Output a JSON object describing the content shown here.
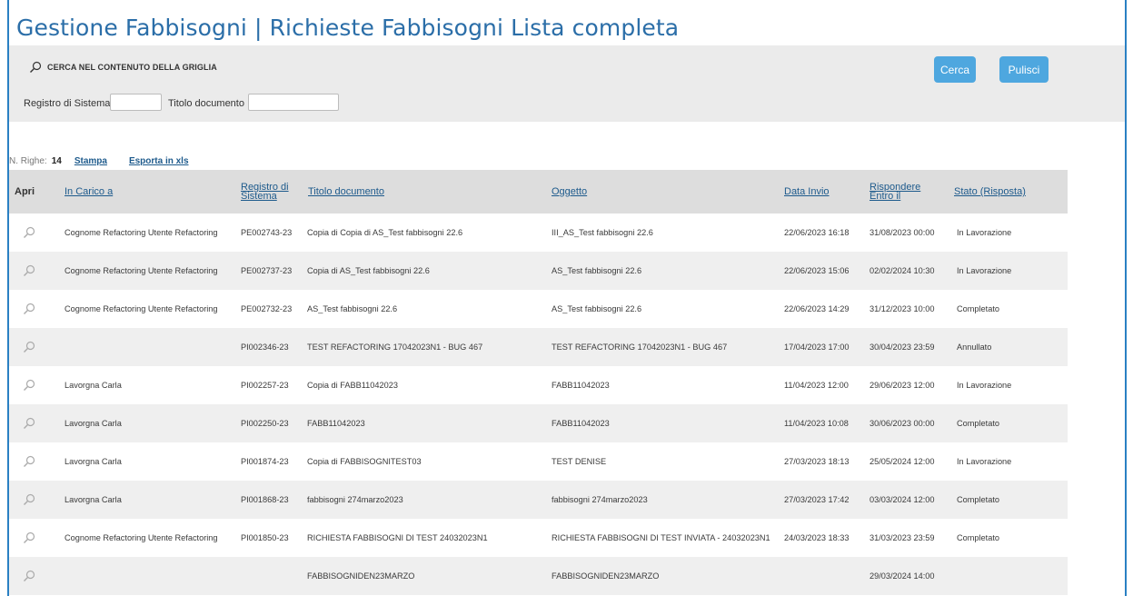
{
  "page": {
    "title": "Gestione Fabbisogni | Richieste Fabbisogni Lista completa"
  },
  "search": {
    "section_label": "CERCA NEL CONTENUTO DELLA GRIGLIA",
    "cerca_label": "Cerca",
    "pulisci_label": "Pulisci",
    "registro_label": "Registro di Sistema",
    "registro_value": "",
    "titolo_label": "Titolo documento",
    "titolo_value": ""
  },
  "toolbar": {
    "rows_label": "N. Righe:",
    "rows_count": "14",
    "stampa_label": "Stampa",
    "esporta_label": "Esporta in xls"
  },
  "table": {
    "headers": {
      "apri": "Apri",
      "in_carico": "In Carico a",
      "registro_1": "Registro di",
      "registro_2": "Sistema",
      "titolo": "Titolo documento",
      "oggetto": "Oggetto",
      "data_invio": "Data Invio",
      "rispondere_1": "Rispondere",
      "rispondere_2": "Entro il",
      "stato": "Stato (Risposta)"
    },
    "rows": [
      {
        "in_carico": "Cognome Refactoring Utente Refactoring",
        "registro": "PE002743-23",
        "titolo": "Copia di Copia di AS_Test fabbisogni 22.6",
        "oggetto": "III_AS_Test fabbisogni 22.6",
        "data_invio": "22/06/2023 16:18",
        "rispondere": "31/08/2023 00:00",
        "stato": "In Lavorazione"
      },
      {
        "in_carico": "Cognome Refactoring Utente Refactoring",
        "registro": "PE002737-23",
        "titolo": "Copia di AS_Test fabbisogni 22.6",
        "oggetto": "AS_Test fabbisogni 22.6",
        "data_invio": "22/06/2023 15:06",
        "rispondere": "02/02/2024 10:30",
        "stato": "In Lavorazione"
      },
      {
        "in_carico": "Cognome Refactoring Utente Refactoring",
        "registro": "PE002732-23",
        "titolo": "AS_Test fabbisogni 22.6",
        "oggetto": "AS_Test fabbisogni 22.6",
        "data_invio": "22/06/2023 14:29",
        "rispondere": "31/12/2023 10:00",
        "stato": "Completato"
      },
      {
        "in_carico": "",
        "registro": "PI002346-23",
        "titolo": "TEST REFACTORING 17042023N1 - BUG 467",
        "oggetto": "TEST REFACTORING 17042023N1 - BUG 467",
        "data_invio": "17/04/2023 17:00",
        "rispondere": "30/04/2023 23:59",
        "stato": "Annullato"
      },
      {
        "in_carico": "Lavorgna Carla",
        "registro": "PI002257-23",
        "titolo": "Copia di FABB11042023",
        "oggetto": "FABB11042023",
        "data_invio": "11/04/2023 12:00",
        "rispondere": "29/06/2023 12:00",
        "stato": "In Lavorazione"
      },
      {
        "in_carico": "Lavorgna Carla",
        "registro": "PI002250-23",
        "titolo": "FABB11042023",
        "oggetto": "FABB11042023",
        "data_invio": "11/04/2023 10:08",
        "rispondere": "30/06/2023 00:00",
        "stato": "Completato"
      },
      {
        "in_carico": "Lavorgna Carla",
        "registro": "PI001874-23",
        "titolo": "Copia di FABBISOGNITEST03",
        "oggetto": "TEST DENISE",
        "data_invio": "27/03/2023 18:13",
        "rispondere": "25/05/2024 12:00",
        "stato": "In Lavorazione"
      },
      {
        "in_carico": "Lavorgna Carla",
        "registro": "PI001868-23",
        "titolo": "fabbisogni 274marzo2023",
        "oggetto": "fabbisogni 274marzo2023",
        "data_invio": "27/03/2023 17:42",
        "rispondere": "03/03/2024 12:00",
        "stato": "Completato"
      },
      {
        "in_carico": "Cognome Refactoring Utente Refactoring",
        "registro": "PI001850-23",
        "titolo": "RICHIESTA FABBISOGNI DI TEST 24032023N1",
        "oggetto": "RICHIESTA FABBISOGNI DI TEST INVIATA - 24032023N1",
        "data_invio": "24/03/2023 18:33",
        "rispondere": "31/03/2023 23:59",
        "stato": "Completato"
      },
      {
        "in_carico": "",
        "registro": "",
        "titolo": "FABBISOGNIDEN23MARZO",
        "oggetto": "FABBISOGNIDEN23MARZO",
        "data_invio": "",
        "rispondere": "29/03/2024 14:00",
        "stato": ""
      }
    ]
  },
  "icons": {
    "search": "magnifier-icon",
    "row_open": "magnifier-icon"
  },
  "colors": {
    "title": "#2b6ea8",
    "button": "#4ea7df",
    "link": "#1d5a8c",
    "panel": "#ebebeb",
    "header": "#dddddd",
    "frame": "#2a80c3"
  }
}
